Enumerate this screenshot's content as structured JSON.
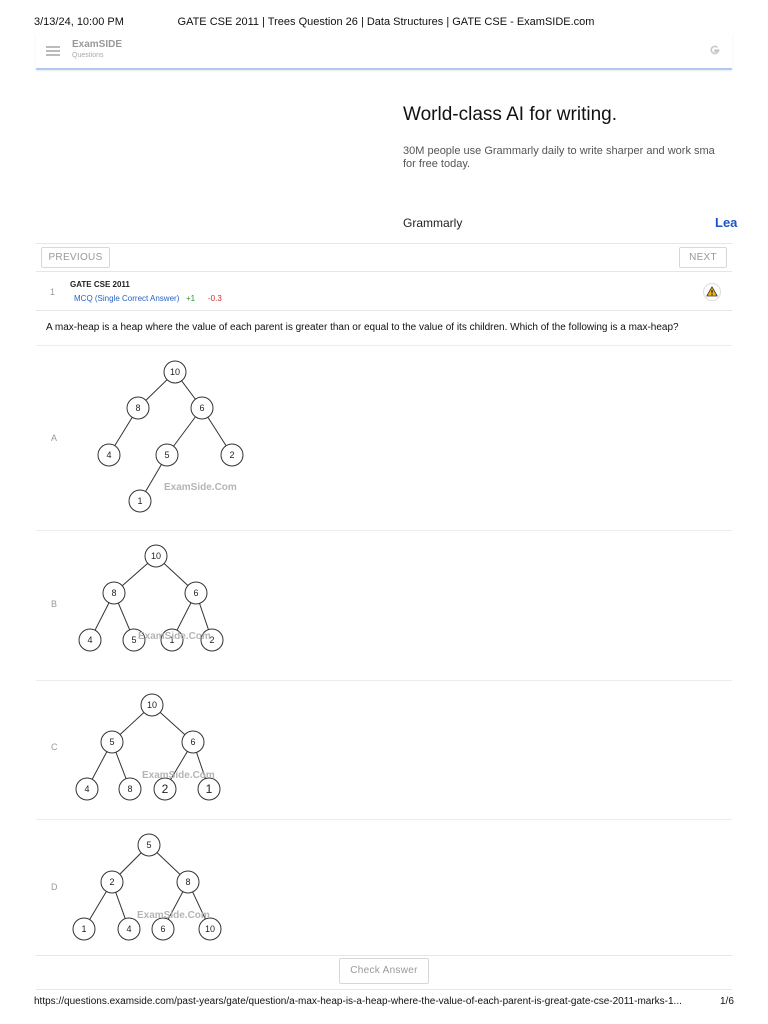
{
  "print_header": {
    "datetime": "3/13/24, 10:00 PM",
    "page_title": "GATE CSE 2011 | Trees Question 26 | Data Structures | GATE CSE - ExamSIDE.com"
  },
  "topbar": {
    "brand_name": "ExamSIDE",
    "brand_sub": "Questions",
    "icons": [
      "menu-icon",
      "google-icon"
    ]
  },
  "ad": {
    "headline": "World-class AI for writing.",
    "body_line1": "30M people use Grammarly daily to write sharper and work sma",
    "body_line2": "for free today.",
    "brand": "Grammarly",
    "cta": "Lea"
  },
  "nav": {
    "previous_label": "PREVIOUS",
    "next_label": "NEXT"
  },
  "question": {
    "number": "1",
    "exam": "GATE CSE 2011",
    "type": "MCQ (Single Correct Answer)",
    "marks_positive": "+1",
    "marks_negative": "-0.3",
    "text": "A max-heap is a heap where the value of each parent is greater than or equal to the value of its children. Which of the following is a max-heap?",
    "report_icon": "warning-icon"
  },
  "options": [
    {
      "label": "A",
      "watermark": "ExamSide.Com",
      "nodes": [
        "10",
        "8",
        "6",
        "4",
        "5",
        "2",
        "1"
      ]
    },
    {
      "label": "B",
      "watermark": "ExamSide.Com",
      "nodes": [
        "10",
        "8",
        "6",
        "4",
        "5",
        "1",
        "2"
      ]
    },
    {
      "label": "C",
      "watermark": "ExamSide.Com",
      "nodes": [
        "10",
        "5",
        "6",
        "4",
        "8",
        "2",
        "1"
      ]
    },
    {
      "label": "D",
      "watermark": "ExamSide.Com",
      "nodes": [
        "5",
        "2",
        "8",
        "1",
        "4",
        "6",
        "10"
      ]
    }
  ],
  "actions": {
    "check_answer_label": "Check Answer"
  },
  "print_footer": {
    "url": "https://questions.examside.com/past-years/gate/question/a-max-heap-is-a-heap-where-the-value-of-each-parent-is-great-gate-cse-2011-marks-1...",
    "page": "1/6"
  }
}
